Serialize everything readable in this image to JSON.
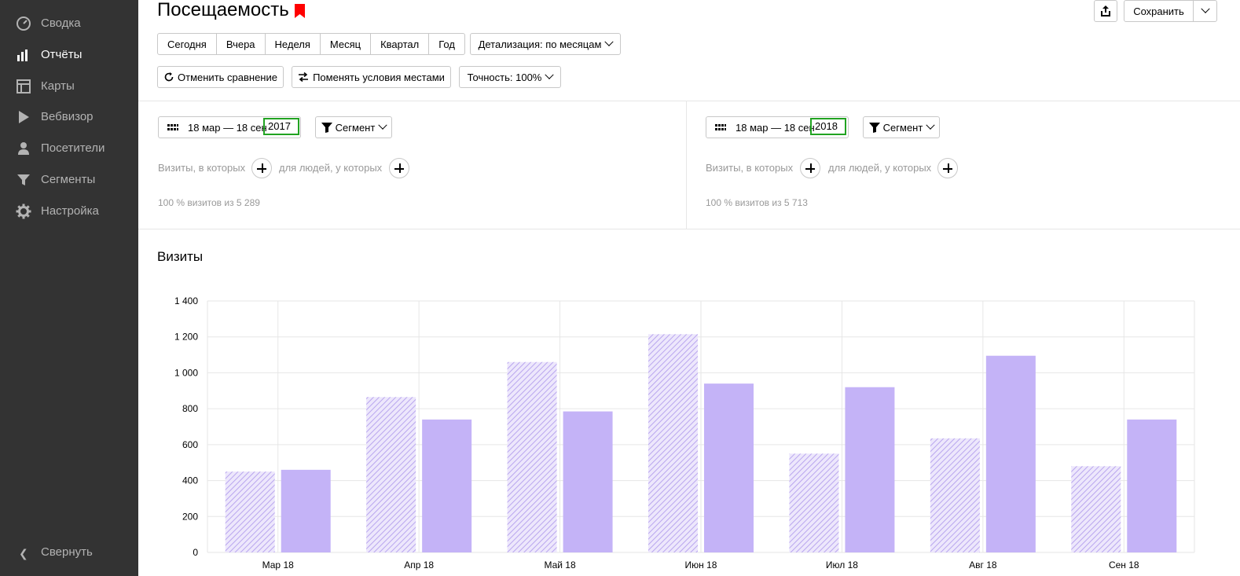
{
  "sidebar": {
    "items": [
      {
        "label": "Сводка",
        "icon": "gauge-icon"
      },
      {
        "label": "Отчёты",
        "icon": "bar-chart-icon",
        "active": true
      },
      {
        "label": "Карты",
        "icon": "map-layout-icon"
      },
      {
        "label": "Вебвизор",
        "icon": "play-icon"
      },
      {
        "label": "Посетители",
        "icon": "user-icon"
      },
      {
        "label": "Сегменты",
        "icon": "filter-icon"
      },
      {
        "label": "Настройка",
        "icon": "gear-icon"
      }
    ],
    "collapse_label": "Свернуть"
  },
  "header": {
    "title": "Посещаемость",
    "save_label": "Сохранить"
  },
  "periods": [
    "Сегодня",
    "Вчера",
    "Неделя",
    "Месяц",
    "Квартал",
    "Год"
  ],
  "detail_label": "Детализация: по месяцам",
  "toolbar": {
    "cancel_compare": "Отменить сравнение",
    "swap_conditions": "Поменять условия местами",
    "accuracy": "Точность: 100%"
  },
  "compare": {
    "left": {
      "range": "18 мар — 18 сен",
      "year": "2017",
      "segment": "Сегмент",
      "visits_where": "Визиты, в которых",
      "people_where": "для людей, у которых",
      "share": "100 % визитов из 5 289"
    },
    "right": {
      "range": "18 мар — 18 сен",
      "year": "2018",
      "segment": "Сегмент",
      "visits_where": "Визиты, в которых",
      "people_where": "для людей, у которых",
      "share": "100 % визитов из 5 713"
    }
  },
  "chart_title": "Визиты",
  "colors": {
    "bar": "#c4b3f7",
    "bar_hatch": "#b9a6ee",
    "sidebar": "#333333",
    "bookmark": "#ff0000",
    "highlight": "#22a322"
  },
  "chart_data": {
    "type": "bar",
    "categories": [
      "Мар 18",
      "Апр 18",
      "Май 18",
      "Июн 18",
      "Июл 18",
      "Авг 18",
      "Сен 18"
    ],
    "series": [
      {
        "values": [
          450,
          865,
          1060,
          1215,
          550,
          635,
          480
        ],
        "style": "hatched"
      },
      {
        "values": [
          460,
          740,
          785,
          940,
          920,
          1095,
          740
        ],
        "style": "solid"
      }
    ],
    "yticks": [
      "0",
      "200",
      "400",
      "600",
      "800",
      "1 000",
      "1 200",
      "1 400"
    ],
    "ylim": [
      0,
      1400
    ],
    "grid": true
  }
}
